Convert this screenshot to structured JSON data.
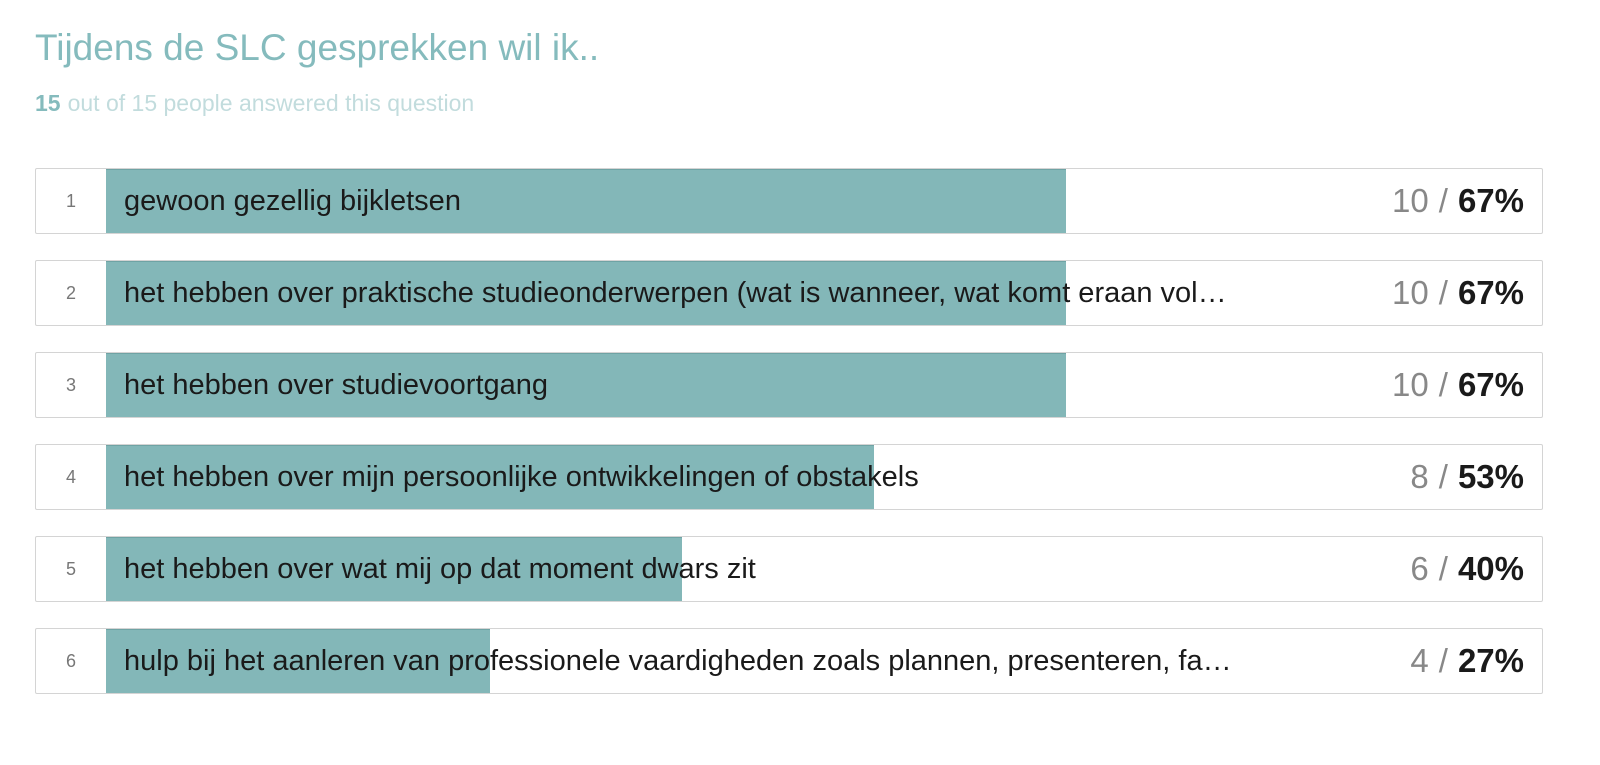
{
  "question": {
    "title": "Tijdens de SLC gesprekken wil ik..",
    "answered_count": "15",
    "answered_text": "out of 15 people answered this question"
  },
  "colors": {
    "accent": "#83b7b8",
    "title": "#85bbbd",
    "subtitle": "#c2dcdd"
  },
  "chart_data": {
    "type": "bar",
    "orientation": "horizontal",
    "total_respondents": 15,
    "rows": [
      {
        "rank": "1",
        "label": "gewoon gezellig bijkletsen",
        "count": "10",
        "percent": "67%",
        "value": 10
      },
      {
        "rank": "2",
        "label": "het hebben over praktische studieonderwerpen (wat is wanneer, wat komt eraan vol…",
        "count": "10",
        "percent": "67%",
        "value": 10
      },
      {
        "rank": "3",
        "label": "het hebben over studievoortgang",
        "count": "10",
        "percent": "67%",
        "value": 10
      },
      {
        "rank": "4",
        "label": "het hebben over mijn persoonlijke ontwikkelingen of obstakels",
        "count": "8",
        "percent": "53%",
        "value": 8
      },
      {
        "rank": "5",
        "label": "het hebben over wat mij op dat moment dwars zit",
        "count": "6",
        "percent": "40%",
        "value": 6
      },
      {
        "rank": "6",
        "label": "hulp bij het aanleren van professionele vaardigheden zoals plannen, presenteren, fa…",
        "count": "4",
        "percent": "27%",
        "value": 4
      }
    ]
  }
}
